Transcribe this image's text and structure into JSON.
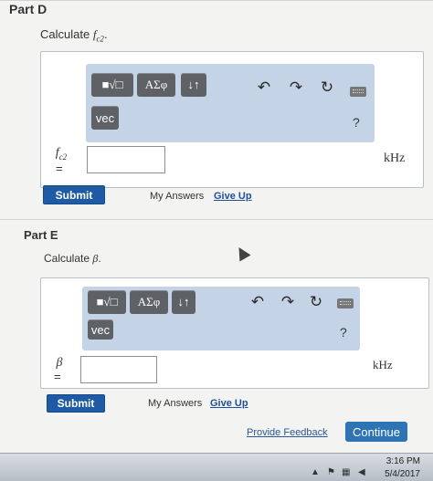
{
  "partD": {
    "title": "Part D",
    "prompt_prefix": "Calculate ",
    "prompt_var": "f",
    "prompt_sub": "c2",
    "prompt_suffix": ".",
    "toolbar": {
      "template_label": "■√□",
      "greek_label": "ΑΣφ",
      "arrows_label": "↓↑",
      "vec_label": "vec",
      "undo_icon": "undo-icon",
      "redo_icon": "redo-icon",
      "reset_icon": "reset-icon",
      "keyboard_icon": "keyboard-icon",
      "help_label": "?"
    },
    "var_label": "f",
    "var_sub": "c2",
    "equals": "=",
    "input_value": "",
    "unit": "kHz",
    "submit_label": "Submit",
    "my_answers": "My Answers",
    "give_up": "Give Up"
  },
  "partE": {
    "title": "Part E",
    "prompt_prefix": "Calculate ",
    "prompt_var": "β",
    "prompt_suffix": ".",
    "toolbar": {
      "template_label": "■√□",
      "greek_label": "ΑΣφ",
      "arrows_label": "↓↑",
      "vec_label": "vec",
      "help_label": "?"
    },
    "var_label": "β",
    "equals": "=",
    "input_value": "",
    "unit": "kHz",
    "submit_label": "Submit",
    "my_answers": "My Answers",
    "give_up": "Give Up"
  },
  "footer": {
    "feedback_label": "Provide Feedback",
    "continue_label": "Continue"
  },
  "taskbar": {
    "time": "3:16 PM",
    "date": "5/4/2017"
  }
}
